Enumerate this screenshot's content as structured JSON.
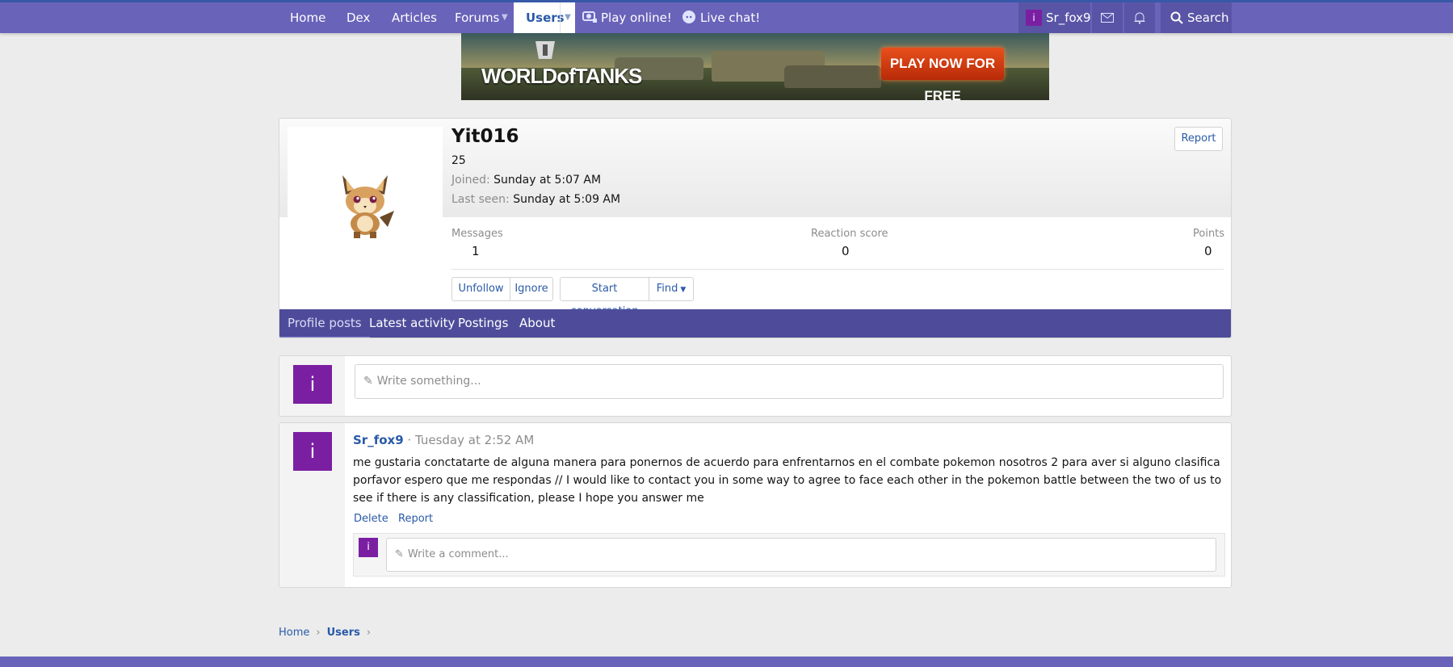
{
  "nav": {
    "home": "Home",
    "dex": "Dex",
    "articles": "Articles",
    "forums": "Forums",
    "users": "Users",
    "play_online": "Play online!",
    "live_chat": "Live chat!",
    "current_user": "Sr_fox9",
    "avatar_letter": "i",
    "search": "Search"
  },
  "banner": {
    "brand": "WORLDofTANKS",
    "cta": "PLAY NOW FOR FREE"
  },
  "profile": {
    "username": "Yit016",
    "title": "25",
    "joined_label": "Joined:",
    "joined_value": "Sunday at 5:07 AM",
    "last_seen_label": "Last seen:",
    "last_seen_value": "Sunday at 5:09 AM",
    "report": "Report",
    "stats": {
      "messages_label": "Messages",
      "messages_value": "1",
      "reaction_label": "Reaction score",
      "reaction_value": "0",
      "points_label": "Points",
      "points_value": "0"
    },
    "actions": {
      "unfollow": "Unfollow",
      "ignore": "Ignore",
      "start_conversation": "Start conversation",
      "find": "Find"
    },
    "tabs": [
      "Profile posts",
      "Latest activity",
      "Postings",
      "About"
    ]
  },
  "composer": {
    "avatar_letter": "i",
    "placeholder": "Write something..."
  },
  "post": {
    "avatar_letter": "i",
    "author": "Sr_fox9",
    "separator": " · ",
    "date": "Tuesday at 2:52 AM",
    "body": "me gustaria conctatarte de alguna manera para ponernos de acuerdo para enfrentarnos en el combate pokemon nosotros 2 para aver si alguno clasifica porfavor espero que me respondas // I would like to contact you in some way to agree to face each other in the pokemon battle between the two of us to see if there is any classification, please I hope you answer me",
    "delete": "Delete",
    "report": "Report",
    "comment_avatar_letter": "i",
    "comment_placeholder": "Write a comment..."
  },
  "breadcrumb": {
    "home": "Home",
    "users": "Users"
  },
  "colors": {
    "navbar": "#6a63ba",
    "tabs": "#4e4c9a",
    "link": "#2a5aa8",
    "avatar": "#7b1fa2"
  }
}
